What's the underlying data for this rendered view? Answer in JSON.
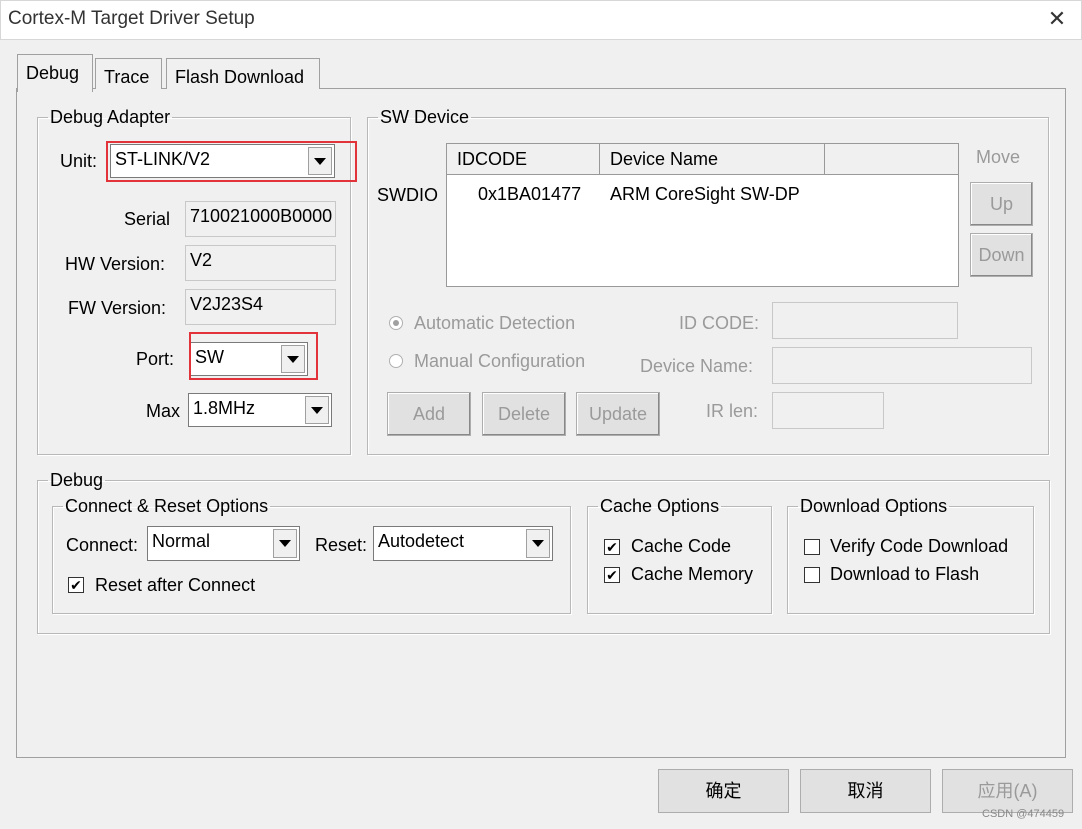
{
  "window": {
    "title": "Cortex-M Target Driver Setup",
    "close_glyph": "✕"
  },
  "tabs": [
    {
      "label": "Debug"
    },
    {
      "label": "Trace"
    },
    {
      "label": "Flash Download"
    }
  ],
  "debug_adapter": {
    "legend": "Debug Adapter",
    "unit_label": "Unit:",
    "unit_value": "ST-LINK/V2",
    "serial_label": "Serial",
    "serial_value": "710021000B0000",
    "hw_label": "HW Version:",
    "hw_value": "V2",
    "fw_label": "FW Version:",
    "fw_value": "V2J23S4",
    "port_label": "Port:",
    "port_value": "SW",
    "max_label": "Max",
    "max_value": "1.8MHz"
  },
  "sw_device": {
    "legend": "SW Device",
    "swdio_label": "SWDIO",
    "columns": [
      "IDCODE",
      "Device Name"
    ],
    "rows": [
      {
        "idcode": "0x1BA01477",
        "device": "ARM CoreSight SW-DP"
      }
    ],
    "move_label": "Move",
    "up_label": "Up",
    "down_label": "Down",
    "auto_label": "Automatic Detection",
    "manual_label": "Manual Configuration",
    "idcode_label": "ID CODE:",
    "devname_label": "Device Name:",
    "irlen_label": "IR len:",
    "add_label": "Add",
    "delete_label": "Delete",
    "update_label": "Update"
  },
  "debug": {
    "legend": "Debug",
    "connect_reset": {
      "legend": "Connect & Reset Options",
      "connect_label": "Connect:",
      "connect_value": "Normal",
      "reset_label": "Reset:",
      "reset_value": "Autodetect",
      "reset_after_label": "Reset after Connect",
      "reset_after_checked": true
    },
    "cache": {
      "legend": "Cache Options",
      "code_label": "Cache Code",
      "code_checked": true,
      "memory_label": "Cache Memory",
      "memory_checked": true
    },
    "download": {
      "legend": "Download Options",
      "verify_label": "Verify Code Download",
      "verify_checked": false,
      "flash_label": "Download to Flash",
      "flash_checked": false
    }
  },
  "footer": {
    "ok_label": "确定",
    "cancel_label": "取消",
    "apply_label": "应用(A)"
  },
  "watermark": "CSDN @474459",
  "colors": {
    "highlight_box": "#e2323a"
  }
}
